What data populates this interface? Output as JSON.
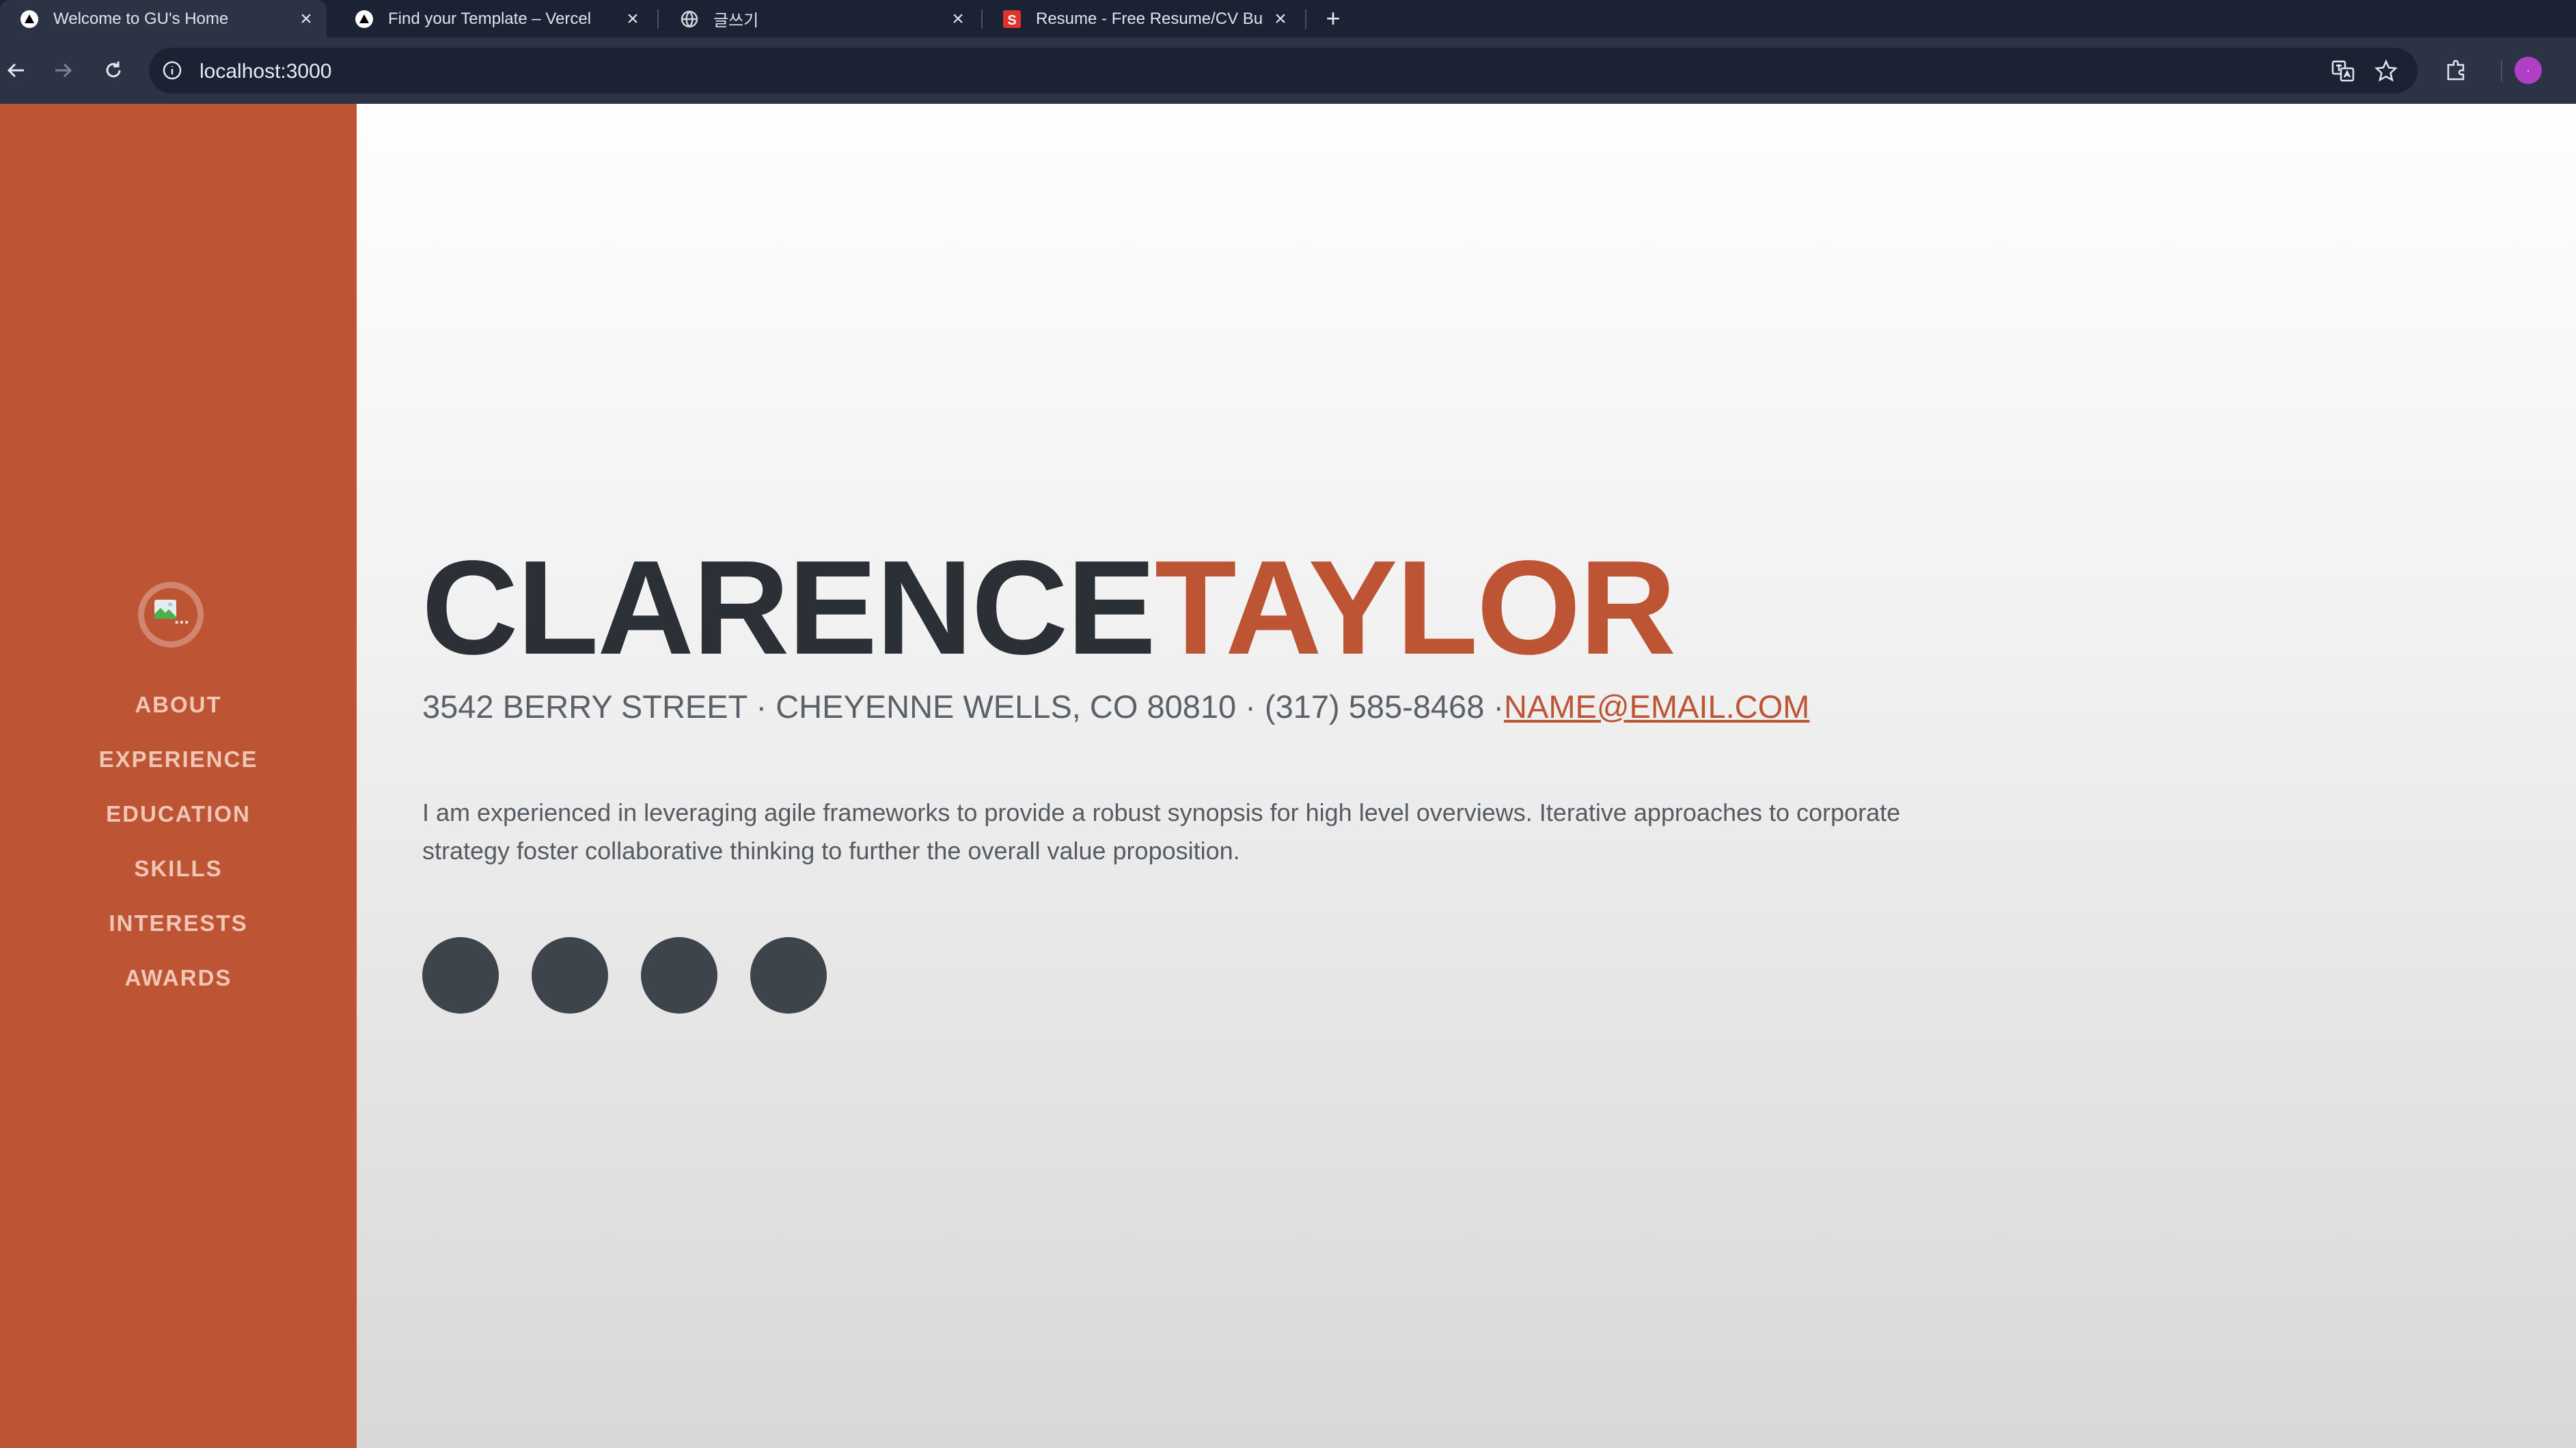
{
  "browser": {
    "tabs": [
      {
        "title": "Welcome to GU's Home",
        "icon": "vercel-triangle-icon",
        "active": true
      },
      {
        "title": "Find your Template – Vercel",
        "icon": "vercel-triangle-icon",
        "active": false
      },
      {
        "title": "글쓰기",
        "icon": "globe-icon",
        "active": false
      },
      {
        "title": "Resume - Free Resume/CV Bu",
        "icon": "s-logo-icon",
        "active": false
      }
    ],
    "url": "localhost:3000",
    "profile_initial": "·"
  },
  "sidebar": {
    "avatar_dots": "...",
    "nav": [
      "ABOUT",
      "EXPERIENCE",
      "EDUCATION",
      "SKILLS",
      "INTERESTS",
      "AWARDS"
    ]
  },
  "main": {
    "first_name": "CLARENCE",
    "last_name": "TAYLOR",
    "address": "3542 BERRY STREET · CHEYENNE WELLS, CO 80810 · (317) 585-8468 ·",
    "email": "NAME@EMAIL.COM",
    "summary": "I am experienced in leveraging agile frameworks to provide a robust synopsis for high level overviews. Iterative approaches to corporate strategy foster collaborative thinking to further the overall value proposition.",
    "social_icons": [
      "social-icon-1",
      "social-icon-2",
      "social-icon-3",
      "social-icon-4"
    ]
  },
  "colors": {
    "accent": "#bd5535",
    "heading": "#2a3035",
    "chrome": "#1b2233"
  }
}
